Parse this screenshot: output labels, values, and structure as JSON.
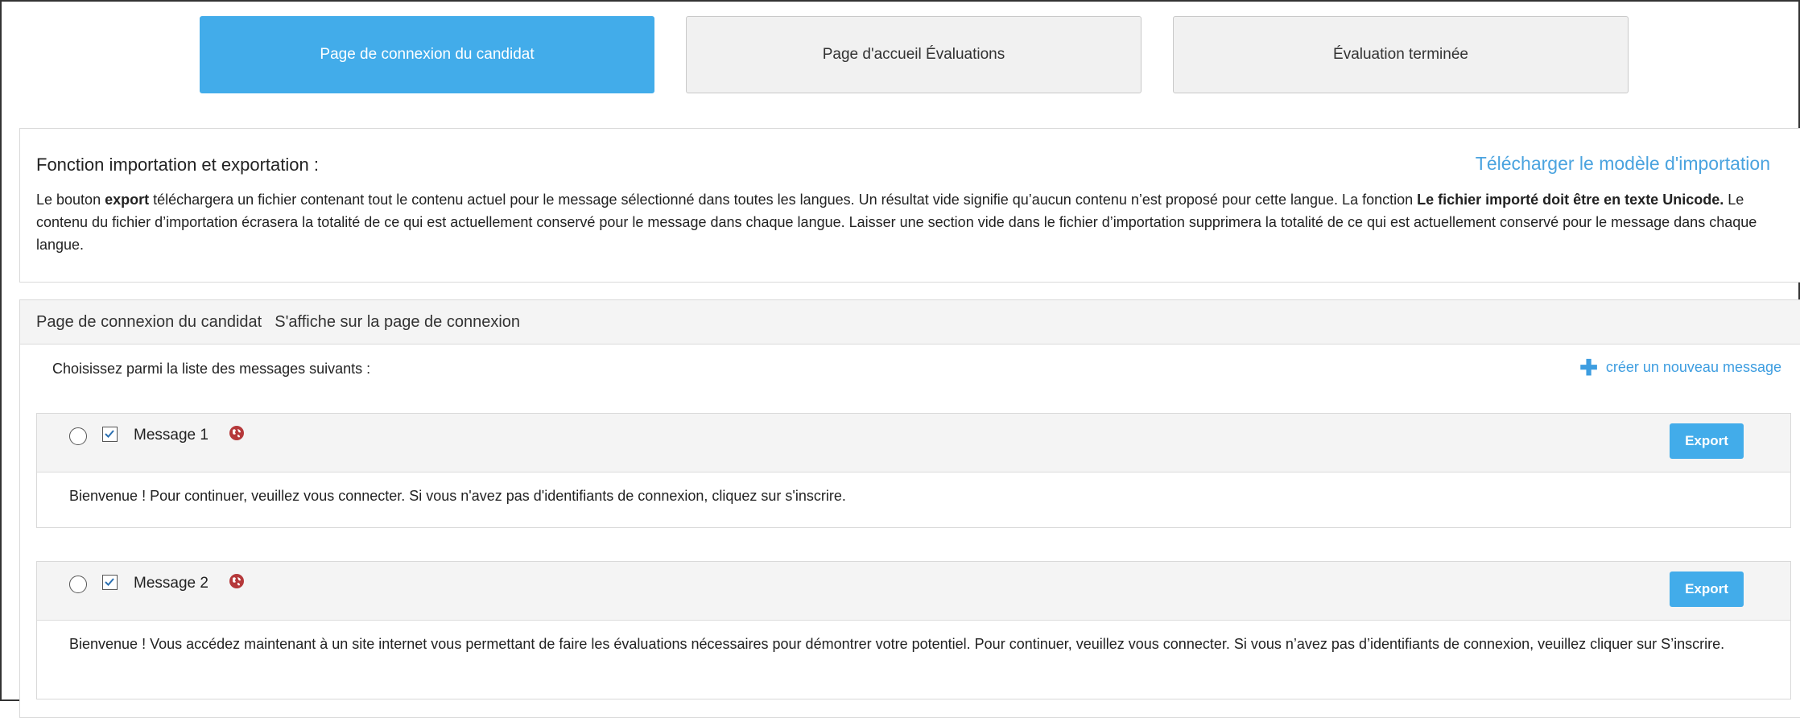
{
  "tabs": [
    {
      "label": "Page de connexion du candidat",
      "active": true
    },
    {
      "label": "Page d'accueil Évaluations",
      "active": false
    },
    {
      "label": "Évaluation terminée",
      "active": false
    }
  ],
  "import_export": {
    "title": "Fonction importation et exportation :",
    "download_link": "Télécharger le modèle d'importation",
    "text_part1": "Le bouton ",
    "text_bold1": "export",
    "text_part2": " téléchargera un fichier contenant tout le contenu actuel pour le message sélectionné dans toutes les langues. Un résultat vide signifie qu’aucun contenu n’est proposé pour cette langue. La fonction ",
    "text_bold2": "Le fichier importé doit être en texte Unicode.",
    "text_part3": " Le contenu du fichier d’importation écrasera la totalité de ce qui est actuellement conservé pour le message dans chaque langue. Laisser une section vide dans le fichier d’importation supprimera la totalité de ce qui est actuellement conservé pour le message dans chaque langue."
  },
  "section": {
    "title": "Page de connexion du candidat",
    "subtitle": "S'affiche sur la page de connexion",
    "choose_label": "Choisissez parmi la liste des messages suivants :",
    "create_link": "créer un nouveau message",
    "messages": [
      {
        "title": "Message 1",
        "export_label": "Export",
        "selected": false,
        "enabled": true,
        "body": "Bienvenue ! Pour continuer, veuillez vous connecter. Si vous n'avez pas d'identifiants de connexion, cliquez sur s'inscrire."
      },
      {
        "title": "Message 2",
        "export_label": "Export",
        "selected": false,
        "enabled": true,
        "body": "Bienvenue !  Vous accédez maintenant à un site internet vous permettant de faire les évaluations nécessaires pour démontrer votre potentiel. Pour continuer, veuillez vous connecter. Si vous n’avez pas d’identifiants de connexion, veuillez cliquer sur S’inscrire."
      }
    ]
  },
  "colors": {
    "accent": "#42acea",
    "link": "#4aa3df",
    "globe": "#b5383a"
  },
  "icons": {
    "plus": "plus-icon",
    "globe": "globe-icon",
    "check": "checkmark-icon"
  }
}
